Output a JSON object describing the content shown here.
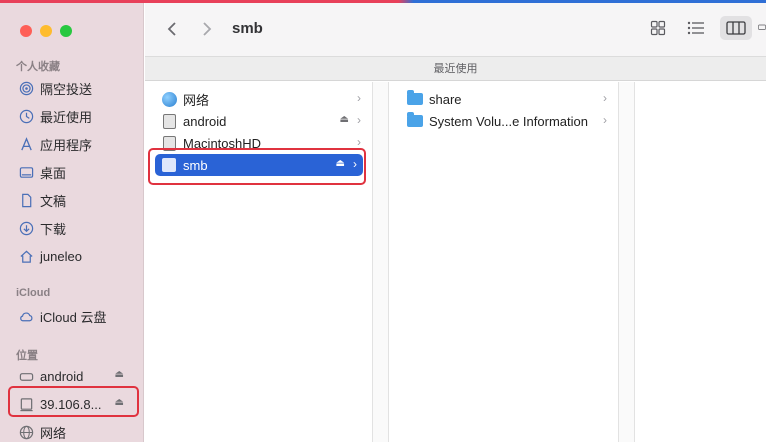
{
  "window": {
    "title": "smb",
    "recents_label": "最近使用"
  },
  "sidebar": {
    "favorites_header": "个人收藏",
    "favorites": [
      {
        "label": "隔空投送",
        "icon": "airdrop-icon"
      },
      {
        "label": "最近使用",
        "icon": "clock-icon"
      },
      {
        "label": "应用程序",
        "icon": "applications-icon"
      },
      {
        "label": "桌面",
        "icon": "desktop-icon"
      },
      {
        "label": "文稿",
        "icon": "document-icon"
      },
      {
        "label": "下载",
        "icon": "download-icon"
      },
      {
        "label": "juneleo",
        "icon": "home-icon"
      }
    ],
    "icloud_header": "iCloud",
    "icloud": [
      {
        "label": "iCloud 云盘",
        "icon": "cloud-icon"
      }
    ],
    "locations_header": "位置",
    "locations": [
      {
        "label": "android",
        "icon": "drive-icon",
        "eject": true
      },
      {
        "label": "39.106.8...",
        "icon": "server-icon",
        "eject": true
      },
      {
        "label": "网络",
        "icon": "network-icon",
        "eject": false
      }
    ]
  },
  "column1": [
    {
      "label": "网络",
      "icon": "network-globe-icon",
      "eject": false,
      "selected": false
    },
    {
      "label": "android",
      "icon": "disk-icon",
      "eject": true,
      "selected": false
    },
    {
      "label": "MacintoshHD",
      "icon": "hard-drive-icon",
      "eject": false,
      "selected": false
    },
    {
      "label": "smb",
      "icon": "server-icon",
      "eject": true,
      "selected": true
    }
  ],
  "column2": [
    {
      "label": "share",
      "icon": "folder-icon"
    },
    {
      "label": "System Volu...e Information",
      "icon": "folder-icon"
    }
  ],
  "colors": {
    "selection": "#2a63d6",
    "highlight_border": "#e0323f",
    "sidebar_bg": "#ead9de"
  }
}
